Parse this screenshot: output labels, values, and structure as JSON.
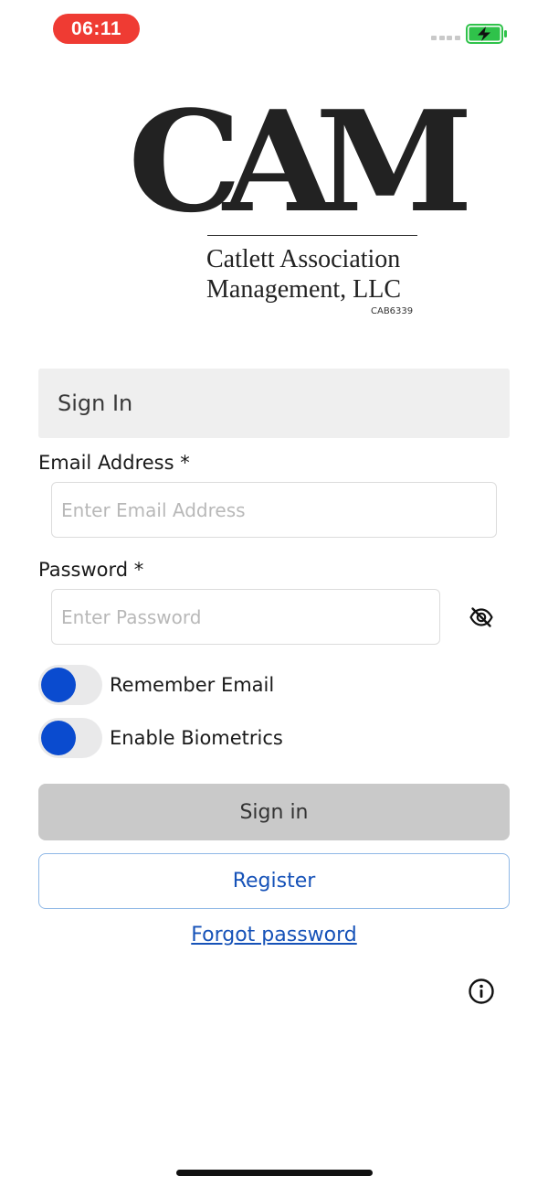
{
  "status_bar": {
    "time": "06:11",
    "battery_icon": "battery-charging-icon",
    "battery_color": "#2fc24a"
  },
  "logo": {
    "monogram": "CAM",
    "company_line1": "Catlett Association",
    "company_line2": "Management, LLC",
    "code": "CAB6339"
  },
  "form": {
    "header": "Sign In",
    "email_label": "Email Address *",
    "email_value": "",
    "email_placeholder": "Enter Email Address",
    "password_label": "Password *",
    "password_value": "",
    "password_placeholder": "Enter Password",
    "password_toggle_icon": "eye-slash-icon",
    "remember_email_label": "Remember Email",
    "enable_biometrics_label": "Enable Biometrics",
    "signin_button": "Sign in",
    "register_button": "Register",
    "forgot_password": "Forgot password",
    "info_icon": "info-icon"
  },
  "colors": {
    "accent": "#0a4bcf",
    "link": "#1652b8",
    "status_time_bg": "#ef3b33"
  }
}
